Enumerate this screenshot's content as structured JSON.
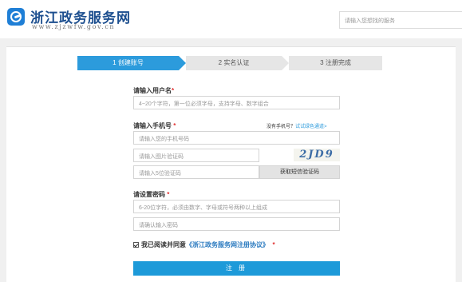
{
  "header": {
    "logo_name": "浙江政务服务网",
    "logo_url": "www.zjzwfw.gov.cn",
    "search_placeholder": "请输入您想找的服务"
  },
  "steps": [
    {
      "label": "1 创建账号",
      "active": true
    },
    {
      "label": "2 实名认证",
      "active": false
    },
    {
      "label": "3 注册完成",
      "active": false
    }
  ],
  "form": {
    "username": {
      "label": "请输入用户名",
      "placeholder": "4~20个字符，第一位必须字母，支持字母、数字组合"
    },
    "phone": {
      "label": "请输入手机号",
      "hint_text": "没有手机号？",
      "hint_link": "试试绿色通道>",
      "placeholder": "请输入您的手机号码",
      "image_code_placeholder": "请输入图片验证码",
      "captcha_text": "2JD9",
      "sms_code_placeholder": "请输入5位验证码",
      "sms_button": "获取短信验证码"
    },
    "password": {
      "label": "请设置密码",
      "placeholder": "6-20位字符，必须由数字、字母或符号两种以上组成",
      "confirm_placeholder": "请确认输入密码"
    },
    "agreement": {
      "prefix": "我已阅读并同意",
      "link": "《浙江政务服务网注册协议》",
      "checked": true
    },
    "submit_label": "注 册"
  },
  "colors": {
    "accent": "#1d9ad9",
    "brand": "#1d4f8f",
    "required": "#e03030"
  }
}
